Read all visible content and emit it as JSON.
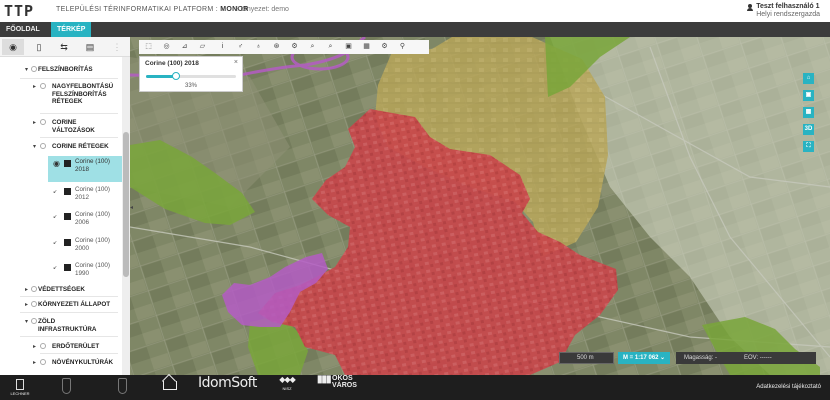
{
  "header": {
    "logo": "TTP",
    "platform_label": "TELEPÜLÉSI TÉRINFORMATIKAI PLATFORM :",
    "platform_name": "MONOR",
    "environment": "Környezet: demo",
    "user_name": "Teszt felhasználó 1",
    "user_role": "Helyi rendszergazda"
  },
  "nav": {
    "tabs": [
      {
        "label": "FŐOLDAL",
        "active": false
      },
      {
        "label": "TÉRKÉP",
        "active": true
      }
    ]
  },
  "sidebar": {
    "tools": [
      "layers-icon",
      "book-icon",
      "share-icon",
      "print-icon"
    ],
    "tree": [
      {
        "label": "FELSZÍNBORÍTÁS",
        "level": 0
      },
      {
        "label": "NAGYFELBONTÁSÚ FELSZÍNBORÍTÁS RÉTEGEK",
        "level": 1
      },
      {
        "label": "CORINE VÁLTOZÁSOK",
        "level": 1
      },
      {
        "label": "CORINE RÉTEGEK",
        "level": 1
      },
      {
        "label": "VÉDETTSÉGEK",
        "level": 0
      },
      {
        "label": "KÖRNYEZETI ÁLLAPOT",
        "level": 0
      },
      {
        "label": "ZÖLD INFRASTRUKTÚRA",
        "level": 0
      },
      {
        "label": "ERDŐTERÜLET",
        "level": 1
      },
      {
        "label": "NÖVÉNYKULTÚRÁK",
        "level": 1
      }
    ],
    "corine_layers": [
      {
        "label": "Corine (100) 2018",
        "active": true
      },
      {
        "label": "Corine (100) 2012",
        "active": false
      },
      {
        "label": "Corine (100) 2006",
        "active": false
      },
      {
        "label": "Corine (100) 2000",
        "active": false
      },
      {
        "label": "Corine (100) 1990",
        "active": false
      }
    ]
  },
  "map": {
    "toolbar_icons": [
      "select-icon",
      "eye-icon",
      "measure-icon",
      "draw-icon",
      "info-icon",
      "marker-icon",
      "pin-icon",
      "route-icon",
      "poi-icon",
      "search-icon",
      "zoom-area-icon",
      "layer-icon",
      "note-icon",
      "settings-icon",
      "pushpin-icon"
    ],
    "opacity_panel": {
      "title": "Corine (100) 2018",
      "value": 0.33,
      "value_label": "33%"
    },
    "right_buttons": [
      "home-icon",
      "layers-icon",
      "grid-icon",
      "3D",
      "fullscreen-icon"
    ],
    "scale_label": "500 m",
    "zoom_label": "M = 1:17 062",
    "height_label": "Magasság: -",
    "eov_label": "EOV: ------",
    "colors": {
      "urban": "#c9454a",
      "agricultural": "#b8a65a",
      "forest": "#79a63a",
      "industrial": "#b45cc4",
      "accent": "#29b3c2"
    }
  },
  "footer": {
    "lechner": "LECHNER",
    "idom": "IdomSoft",
    "nisz": "NISZ",
    "okos_line1": "OKOS",
    "okos_line2": "VÁROS",
    "privacy": "Adatkezelési tájékoztató"
  }
}
